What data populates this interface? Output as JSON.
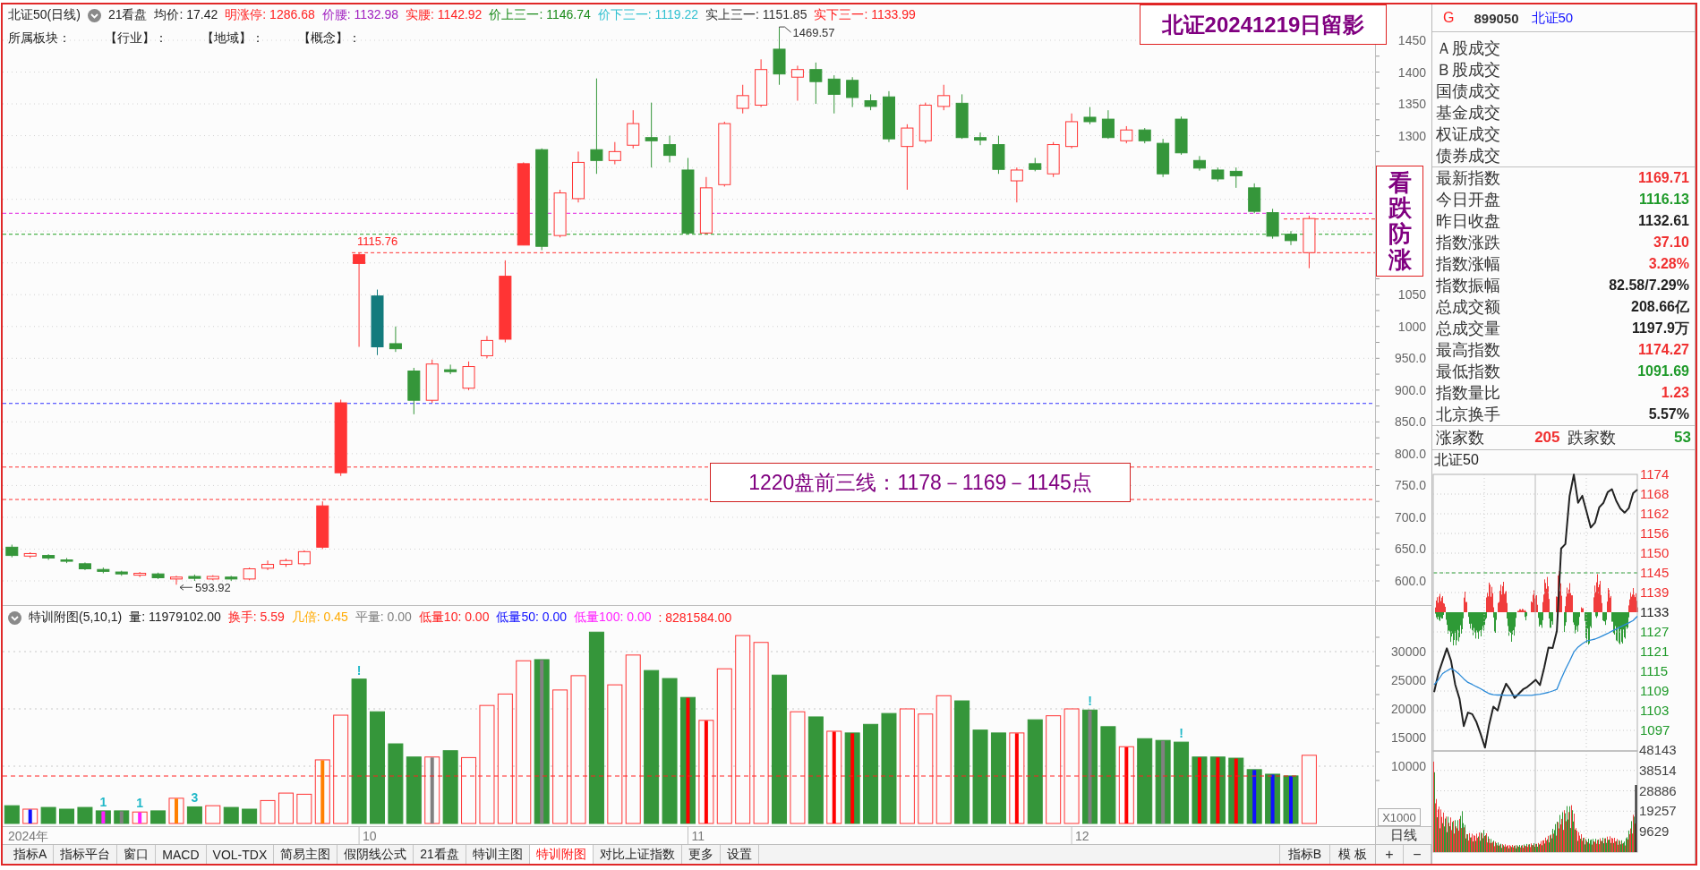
{
  "header": {
    "title": "北证50(日线)",
    "menu": "21看盘",
    "stats": [
      {
        "text": "均价: 17.42",
        "color": "#202020"
      },
      {
        "text": "明涨停: 1286.68",
        "color": "#ff2020"
      },
      {
        "text": "价腰: 1132.98",
        "color": "#a020c0"
      },
      {
        "text": "实腰: 1142.92",
        "color": "#ff2020"
      },
      {
        "text": "价上三一: 1146.74",
        "color": "#1a8a1a"
      },
      {
        "text": "价下三一: 1119.22",
        "color": "#30c0d0"
      },
      {
        "text": "实上三一: 1151.85",
        "color": "#303030"
      },
      {
        "text": "实下三一: 1133.99",
        "color": "#ff2020"
      }
    ]
  },
  "sector_row": [
    "所属板块：",
    "【行业】：",
    "【地域】：",
    "【概念】："
  ],
  "notes": [
    {
      "kind": "banner",
      "text": "北证20241219日留影"
    },
    {
      "kind": "vertical",
      "text": "看跌防涨"
    },
    {
      "kind": "plan",
      "text": "1220盘前三线：1178－1169－1145点"
    }
  ],
  "price_chart": {
    "high_label": "1469.57",
    "gap_label": "1115.76",
    "low_label": "593.92",
    "axis_labels": [
      "1450",
      "1400",
      "1350",
      "1300",
      "1050",
      "1000",
      "950.0",
      "900.0",
      "850.0",
      "800.0",
      "750.0",
      "700.0",
      "650.0",
      "600.0"
    ]
  },
  "indicator_panel": {
    "title": "特训附图(5,10,1)",
    "stats": [
      {
        "text": "量: 11979102.00",
        "color": "#202020"
      },
      {
        "text": "换手: 5.59",
        "color": "#ff2020"
      },
      {
        "text": "几倍: 0.45",
        "color": "#ffaa00"
      },
      {
        "text": "平量: 0.00",
        "color": "#808080"
      },
      {
        "text": "低量10: 0.00",
        "color": "#ff2020"
      },
      {
        "text": "低量50: 0.00",
        "color": "#1010ff"
      },
      {
        "text": "低量100: 0.00",
        "color": "#ff20ff"
      },
      {
        "text": ": 8281584.00",
        "color": "#ff2020"
      }
    ],
    "markers": [
      "1",
      "1",
      "3",
      "!",
      "!",
      "!"
    ],
    "axis_labels": [
      "30000",
      "25000",
      "20000",
      "15000",
      "10000"
    ],
    "unit": "X1000"
  },
  "date_axis": [
    "2024年",
    "10",
    "11",
    "12"
  ],
  "tabs": [
    {
      "label": "指标A",
      "selected": false
    },
    {
      "label": "指标平台",
      "selected": false
    },
    {
      "label": "窗口",
      "selected": false
    },
    {
      "label": "MACD",
      "selected": false
    },
    {
      "label": "VOL-TDX",
      "selected": false
    },
    {
      "label": "简易主图",
      "selected": false
    },
    {
      "label": "假阴线公式",
      "selected": false
    },
    {
      "label": "21看盘",
      "selected": false
    },
    {
      "label": "特训主图",
      "selected": false
    },
    {
      "label": "特训附图",
      "selected": true
    },
    {
      "label": "对比上证指数",
      "selected": false
    },
    {
      "label": "更多",
      "selected": false
    },
    {
      "label": "设置",
      "selected": false
    }
  ],
  "side_tabs": [
    "指标B",
    "模 板"
  ],
  "period": "日线",
  "zoom_buttons": [
    "+",
    "−"
  ],
  "quote_panel": {
    "market": "G",
    "code": "899050",
    "name": "北证50",
    "turnover_rows": [
      "Ａ股成交",
      "Ｂ股成交",
      "国债成交",
      "基金成交",
      "权证成交",
      "债券成交"
    ],
    "quotes": [
      {
        "label": "最新指数",
        "value": "1169.71",
        "color": "#f03030"
      },
      {
        "label": "今日开盘",
        "value": "1116.13",
        "color": "#1f9a2a"
      },
      {
        "label": "昨日收盘",
        "value": "1132.61",
        "color": "#222222"
      },
      {
        "label": "指数涨跌",
        "value": "37.10",
        "color": "#f03030"
      },
      {
        "label": "指数涨幅",
        "value": "3.28%",
        "color": "#f03030"
      },
      {
        "label": "指数振幅",
        "value": "82.58/7.29%",
        "color": "#222222"
      },
      {
        "label": "总成交额",
        "value": "208.66亿",
        "color": "#222222"
      },
      {
        "label": "总成交量",
        "value": "1197.9万",
        "color": "#222222"
      },
      {
        "label": "最高指数",
        "value": "1174.27",
        "color": "#f03030"
      },
      {
        "label": "最低指数",
        "value": "1091.69",
        "color": "#1f9a2a"
      },
      {
        "label": "指数量比",
        "value": "1.23",
        "color": "#f03030"
      },
      {
        "label": "北京换手",
        "value": "5.57%",
        "color": "#222222"
      }
    ],
    "breadth": [
      {
        "label": "涨家数",
        "count": "205",
        "color": "#f03030"
      },
      {
        "label": "跌家数",
        "count": "53",
        "color": "#1f9a2a"
      }
    ],
    "intraday": {
      "title": "北证50",
      "chart_data": {
        "type": "line",
        "grid": true,
        "ylim": [
          1090.69,
          1174.27
        ],
        "yticks": [
          {
            "value": 1174.27,
            "label": "1174"
          },
          {
            "value": 1168.32,
            "label": "1168"
          },
          {
            "value": 1162.37,
            "label": "1162"
          },
          {
            "value": 1156.41,
            "label": "1156"
          },
          {
            "value": 1150.46,
            "label": "1150"
          },
          {
            "value": 1144.51,
            "label": "1145"
          },
          {
            "value": 1138.56,
            "label": "1139"
          },
          {
            "value": 1132.61,
            "label": "1133"
          },
          {
            "value": 1126.66,
            "label": "1127"
          },
          {
            "value": 1120.71,
            "label": "1121"
          },
          {
            "value": 1114.76,
            "label": "1115"
          },
          {
            "value": 1108.8,
            "label": "1109"
          },
          {
            "value": 1102.85,
            "label": "1103"
          },
          {
            "value": 1096.9,
            "label": "1097"
          }
        ],
        "series": [
          {
            "color": "#222222",
            "values": [
              1108.5,
              1114.1,
              1117.9,
              1121.7,
              1117.9,
              1110.7,
              1106.4,
              1098.2,
              1102.3,
              1101.8,
              1099.4,
              1095.8,
              1091.7,
              1098.7,
              1104.1,
              1102.9,
              1107.8,
              1111.0,
              1109.2,
              1106.7,
              1108.0,
              1109.3,
              1110.0,
              1111.1,
              1112.2,
              1110.6,
              1115.9,
              1121.9,
              1121.8,
              1126.9,
              1151.9,
              1153.2,
              1167.7,
              1174.2,
              1165.7,
              1167.8,
              1163.0,
              1158.2,
              1159.7,
              1164.3,
              1165.7,
              1168.9,
              1169.8,
              1166.3,
              1163.9,
              1162.7,
              1164.1,
              1168.6,
              1169.7
            ]
          },
          {
            "color": "#2a8ad8",
            "values": [
              1110.7,
              1112.2,
              1114.1,
              1114.9,
              1115.6,
              1114.9,
              1113.8,
              1112.5,
              1111.4,
              1110.8,
              1110.1,
              1109.5,
              1108.7,
              1108.0,
              1107.7,
              1107.6,
              1107.6,
              1107.5,
              1107.5,
              1107.5,
              1107.5,
              1107.5,
              1107.5,
              1107.5,
              1107.7,
              1107.8,
              1108.1,
              1108.4,
              1108.8,
              1109.3,
              1112.5,
              1115.3,
              1117.8,
              1120.6,
              1122.1,
              1123.1,
              1123.9,
              1124.2,
              1124.5,
              1125.0,
              1125.6,
              1126.2,
              1126.9,
              1127.5,
              1128.2,
              1128.8,
              1129.4,
              1130.1,
              1131.4
            ]
          }
        ]
      },
      "volume_labels": [
        "48143",
        "38514",
        "28886",
        "19257",
        "9629"
      ]
    }
  }
}
